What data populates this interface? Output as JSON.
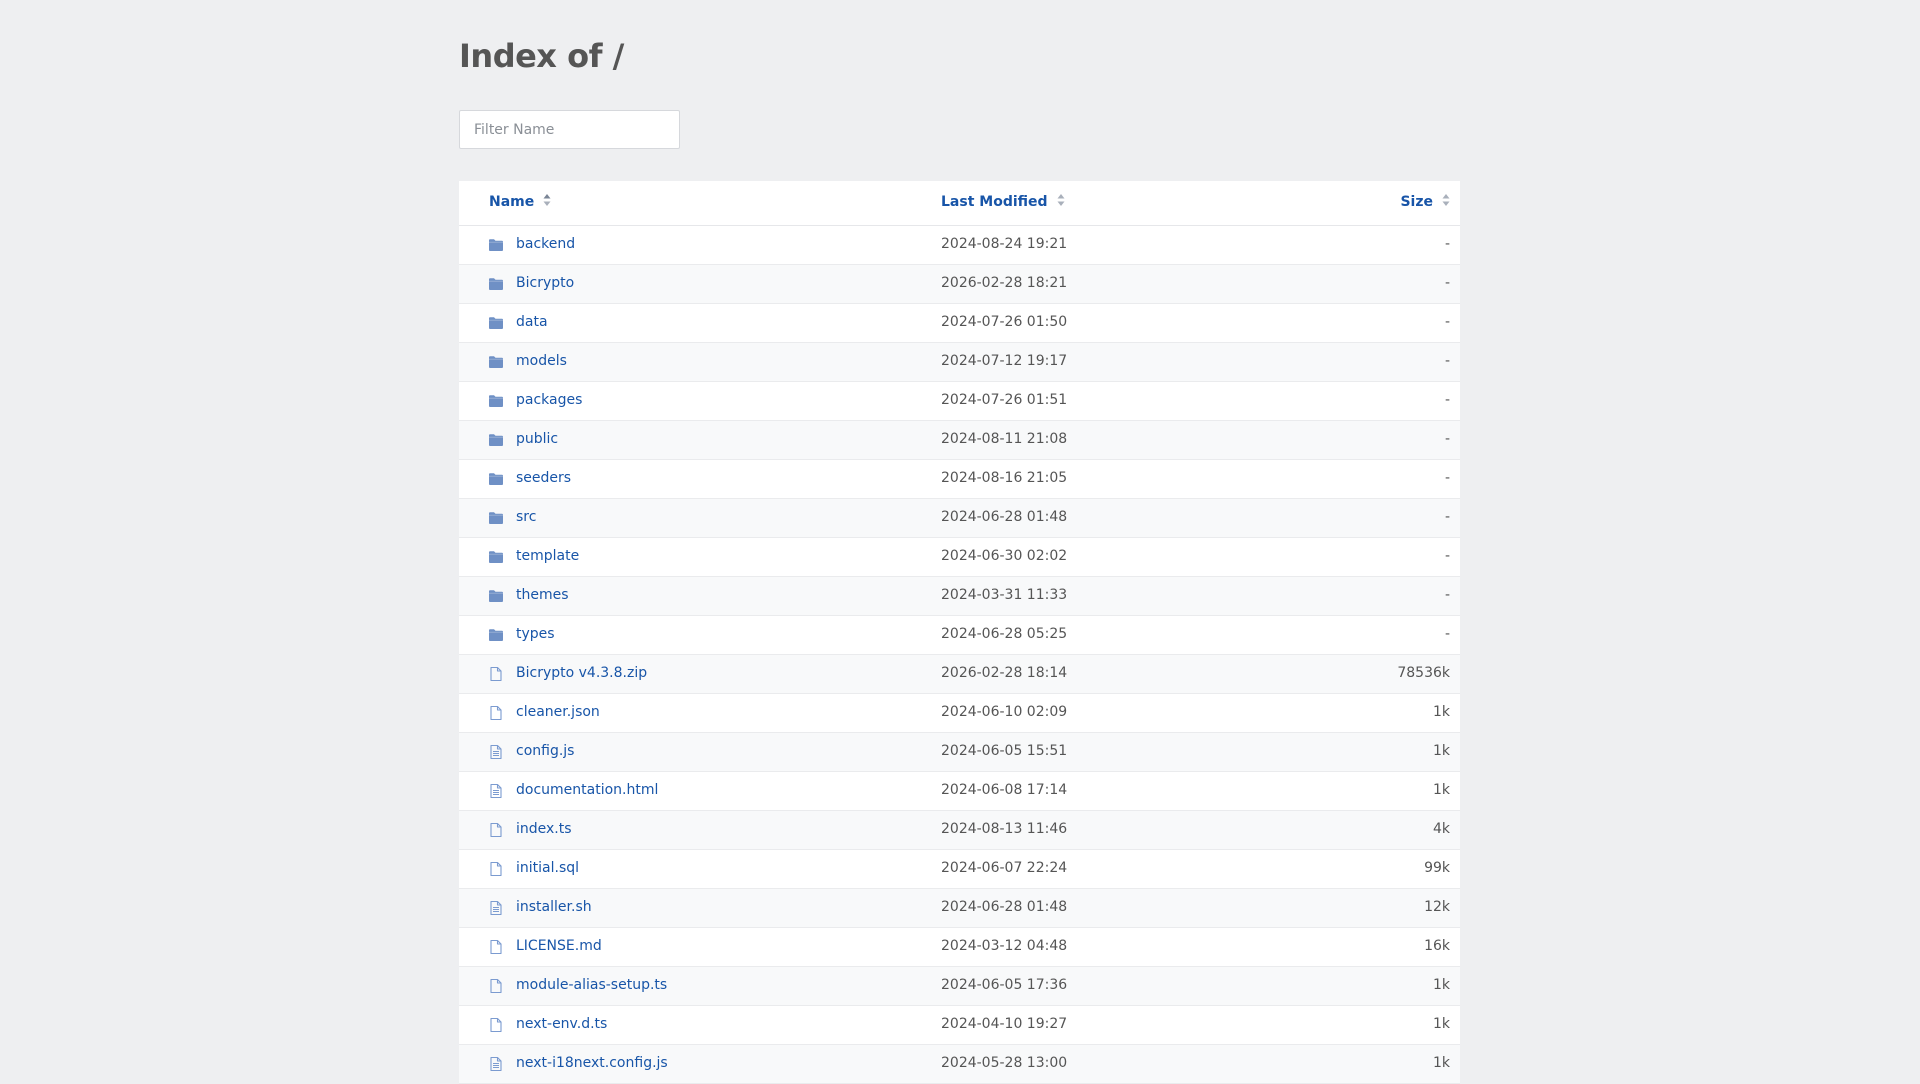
{
  "page": {
    "title": "Index of /",
    "filter_placeholder": "Filter Name"
  },
  "table": {
    "headers": {
      "name": "Name",
      "modified": "Last Modified",
      "size": "Size"
    },
    "rows": [
      {
        "type": "folder",
        "name": "backend",
        "modified": "2024-08-24 19:21",
        "size": "-"
      },
      {
        "type": "folder",
        "name": "Bicrypto",
        "modified": "2026-02-28 18:21",
        "size": "-"
      },
      {
        "type": "folder",
        "name": "data",
        "modified": "2024-07-26 01:50",
        "size": "-"
      },
      {
        "type": "folder",
        "name": "models",
        "modified": "2024-07-12 19:17",
        "size": "-"
      },
      {
        "type": "folder",
        "name": "packages",
        "modified": "2024-07-26 01:51",
        "size": "-"
      },
      {
        "type": "folder",
        "name": "public",
        "modified": "2024-08-11 21:08",
        "size": "-"
      },
      {
        "type": "folder",
        "name": "seeders",
        "modified": "2024-08-16 21:05",
        "size": "-"
      },
      {
        "type": "folder",
        "name": "src",
        "modified": "2024-06-28 01:48",
        "size": "-"
      },
      {
        "type": "folder",
        "name": "template",
        "modified": "2024-06-30 02:02",
        "size": "-"
      },
      {
        "type": "folder",
        "name": "themes",
        "modified": "2024-03-31 11:33",
        "size": "-"
      },
      {
        "type": "folder",
        "name": "types",
        "modified": "2024-06-28 05:25",
        "size": "-"
      },
      {
        "type": "file",
        "name": "Bicrypto v4.3.8.zip",
        "modified": "2026-02-28 18:14",
        "size": "78536k"
      },
      {
        "type": "file",
        "name": "cleaner.json",
        "modified": "2024-06-10 02:09",
        "size": "1k"
      },
      {
        "type": "text-file",
        "name": "config.js",
        "modified": "2024-06-05 15:51",
        "size": "1k"
      },
      {
        "type": "text-file",
        "name": "documentation.html",
        "modified": "2024-06-08 17:14",
        "size": "1k"
      },
      {
        "type": "file",
        "name": "index.ts",
        "modified": "2024-08-13 11:46",
        "size": "4k"
      },
      {
        "type": "file",
        "name": "initial.sql",
        "modified": "2024-06-07 22:24",
        "size": "99k"
      },
      {
        "type": "text-file",
        "name": "installer.sh",
        "modified": "2024-06-28 01:48",
        "size": "12k"
      },
      {
        "type": "file",
        "name": "LICENSE.md",
        "modified": "2024-03-12 04:48",
        "size": "16k"
      },
      {
        "type": "file",
        "name": "module-alias-setup.ts",
        "modified": "2024-06-05 17:36",
        "size": "1k"
      },
      {
        "type": "file",
        "name": "next-env.d.ts",
        "modified": "2024-04-10 19:27",
        "size": "1k"
      },
      {
        "type": "text-file",
        "name": "next-i18next.config.js",
        "modified": "2024-05-28 13:00",
        "size": "1k"
      }
    ]
  },
  "colors": {
    "background": "#eeeff1",
    "link": "#1855a8",
    "folder_icon": "#6f90c5",
    "file_icon": "#7b9bd0"
  }
}
